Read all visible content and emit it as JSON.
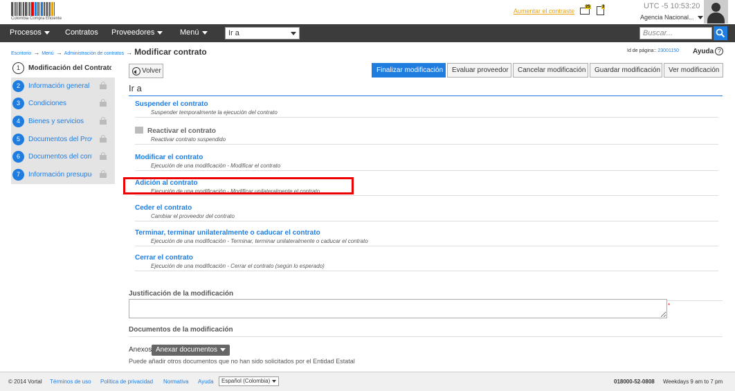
{
  "header": {
    "logo_text": "Colombia Compra Eficiente",
    "contrast_link": "Aumentar el contraste",
    "notifications": [
      {
        "icon": "envelope-icon",
        "count": "25"
      },
      {
        "icon": "tasks-icon",
        "count": "3"
      }
    ],
    "utc_label": "UTC -5",
    "time": "10:53:20",
    "agency": "Agencia Nacional..."
  },
  "nav": {
    "items": [
      "Procesos",
      "Contratos",
      "Proveedores",
      "Menú"
    ],
    "ira_value": "Ir a",
    "search_placeholder": "Buscar..."
  },
  "breadcrumb": {
    "items": [
      "Escritorio",
      "Menú",
      "Administración de contratos"
    ],
    "current": "Modificar contrato"
  },
  "page_id": {
    "label": "Id de página::",
    "value": "23001150"
  },
  "help_label": "Ayuda",
  "sidebar": {
    "steps": [
      {
        "num": "1",
        "label": "Modificación del Contrato",
        "active": true
      },
      {
        "num": "2",
        "label": "Información general",
        "locked": true
      },
      {
        "num": "3",
        "label": "Condiciones",
        "locked": true
      },
      {
        "num": "4",
        "label": "Bienes y servicios",
        "locked": true
      },
      {
        "num": "5",
        "label": "Documentos del Prov...",
        "locked": true
      },
      {
        "num": "6",
        "label": "Documentos del contr...",
        "locked": true
      },
      {
        "num": "7",
        "label": "Información presupue...",
        "locked": true
      }
    ]
  },
  "toolbar": {
    "back": "Volver",
    "buttons": [
      "Finalizar modificación",
      "Evaluar proveedor",
      "Cancelar modificación",
      "Guardar modificación",
      "Ver modificación"
    ]
  },
  "ira_title": "Ir a",
  "actions": [
    {
      "title": "Suspender el contrato",
      "desc": "Suspender temporalmente la ejecución del contrato"
    },
    {
      "title": "Reactivar el contrato",
      "desc": "Reactivar contrato suspendido",
      "disabled": true
    },
    {
      "title": "Modificar el contrato",
      "desc": "Ejecución de una modificación - Modificar el contrato"
    },
    {
      "title": "Adición al contrato",
      "desc": "Ejecución de una modificación - Modificar unilateralmente el contrato"
    },
    {
      "title": "Ceder el contrato",
      "desc": "Cambiar el proveedor del contrato"
    },
    {
      "title": "Terminar, terminar unilateralmente o caducar el contrato",
      "desc": "Ejecución de una modificación - Terminar, terminar unilateralmente o caducar el contrato"
    },
    {
      "title": "Cerrar el contrato",
      "desc": "Ejecución de una modificación - Cerrar el contrato (según lo esperado)"
    }
  ],
  "justification_label": "Justificación de la modificación",
  "required_mark": "*",
  "documents_label": "Documentos de la modificación",
  "anexos": {
    "label": "Anexos",
    "button": "Anexar documentos",
    "note": "Puede añadir otros documentos que no han sido solicitados por el Entidad Estatal"
  },
  "footer": {
    "copyright": "© 2014 Vortal",
    "links": [
      "Términos de uso",
      "Política de privacidad",
      "Normativa",
      "Ayuda"
    ],
    "language": "Español (Colombia)",
    "phone": "018000-52-0808",
    "hours": "Weekdays 9 am to 7 pm"
  }
}
